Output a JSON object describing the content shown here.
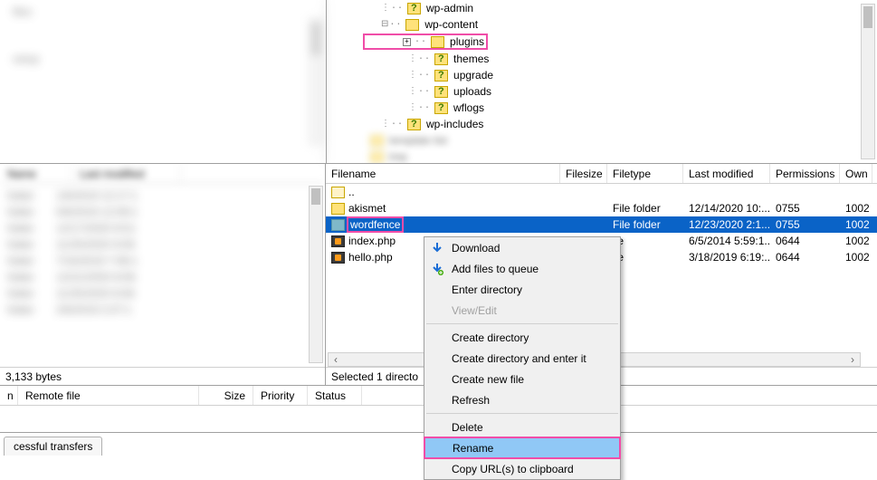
{
  "tree": {
    "wp_admin": "wp-admin",
    "wp_content": "wp-content",
    "plugins": "plugins",
    "themes": "themes",
    "upgrade": "upgrade",
    "uploads": "uploads",
    "wflogs": "wflogs",
    "wp_includes": "wp-includes"
  },
  "columns": {
    "filename": "Filename",
    "filesize": "Filesize",
    "filetype": "Filetype",
    "last_modified": "Last modified",
    "permissions": "Permissions",
    "owner": "Own"
  },
  "rows": {
    "parent": {
      "name": ".."
    },
    "akismet": {
      "name": "akismet",
      "type": "File folder",
      "mod": "12/14/2020 10:...",
      "perm": "0755",
      "own": "1002"
    },
    "wordfence": {
      "name": "wordfence",
      "type": "File folder",
      "mod": "12/23/2020 2:1...",
      "perm": "0755",
      "own": "1002"
    },
    "indexphp": {
      "name": "index.php",
      "type_tail": "ile",
      "mod": "6/5/2014 5:59:1...",
      "perm": "0644",
      "own": "1002"
    },
    "hellophp": {
      "name": "hello.php",
      "type_tail": "ile",
      "mod": "3/18/2019 6:19:...",
      "perm": "0644",
      "own": "1002"
    }
  },
  "status": {
    "left": "3,133 bytes",
    "right": "Selected 1 directo"
  },
  "bottom_columns": {
    "c1": "n",
    "c2": "Remote file",
    "c3": "Size",
    "c4": "Priority",
    "c5": "Status"
  },
  "tab": {
    "label": "cessful transfers"
  },
  "context_menu": {
    "download": "Download",
    "add_queue": "Add files to queue",
    "enter_dir": "Enter directory",
    "view_edit": "View/Edit",
    "create_dir": "Create directory",
    "create_dir_enter": "Create directory and enter it",
    "create_file": "Create new file",
    "refresh": "Refresh",
    "delete": "Delete",
    "rename": "Rename",
    "copy_urls": "Copy URL(s) to clipboard"
  }
}
